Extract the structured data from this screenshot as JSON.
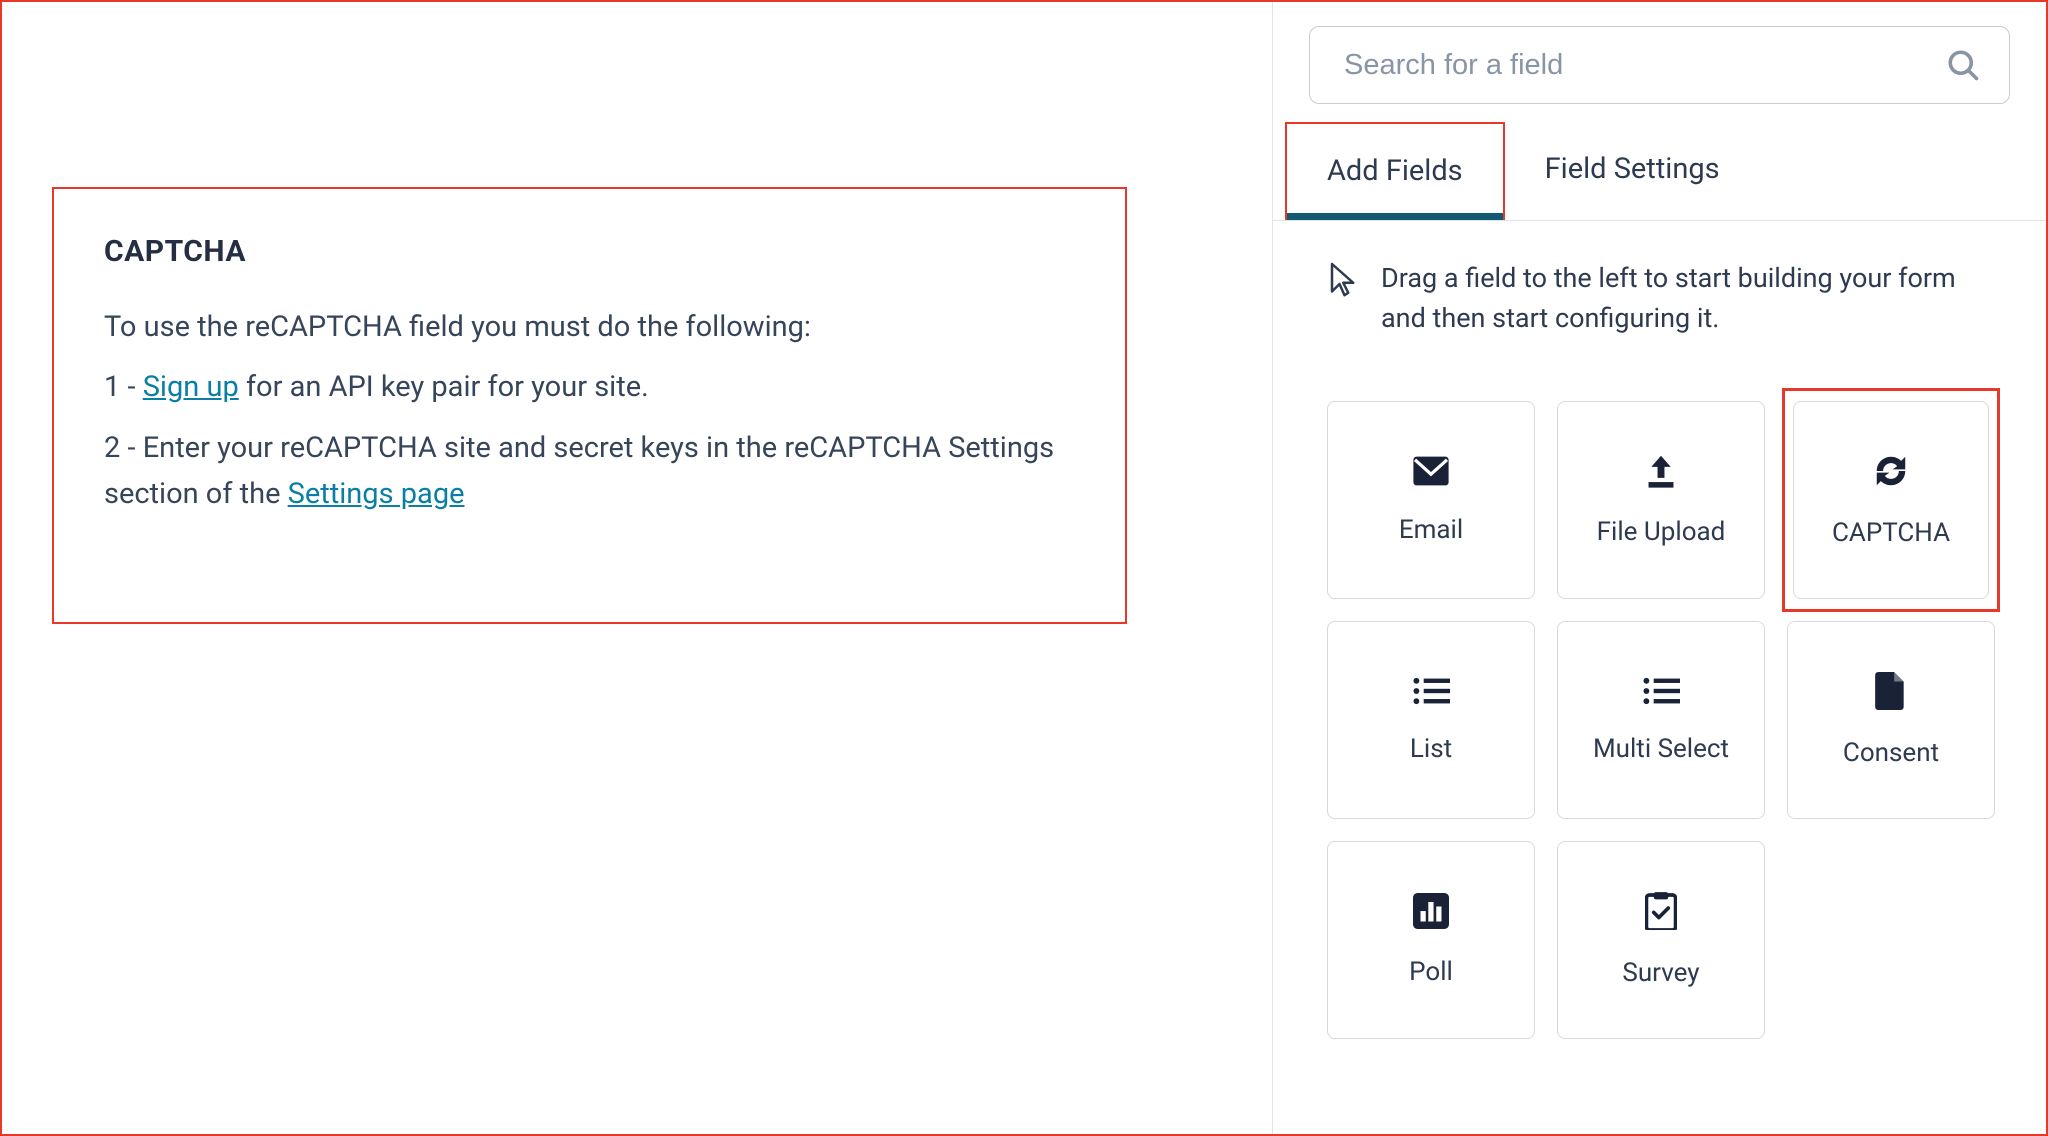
{
  "left": {
    "title": "CAPTCHA",
    "intro": "To use the reCAPTCHA field you must do the following:",
    "step1_prefix": "1 - ",
    "step1_link": "Sign up",
    "step1_suffix": " for an API key pair for your site.",
    "step2_prefix": "2 - Enter your reCAPTCHA site and secret keys in the reCAPTCHA Settings section of the ",
    "step2_link": "Settings page"
  },
  "search": {
    "placeholder": "Search for a field"
  },
  "tabs": {
    "add_fields": "Add Fields",
    "field_settings": "Field Settings"
  },
  "hint": "Drag a field to the left to start building your form and then start configuring it.",
  "fields": {
    "email": "Email",
    "file_upload": "File Upload",
    "captcha": "CAPTCHA",
    "list": "List",
    "multi_select": "Multi Select",
    "consent": "Consent",
    "poll": "Poll",
    "survey": "Survey"
  }
}
